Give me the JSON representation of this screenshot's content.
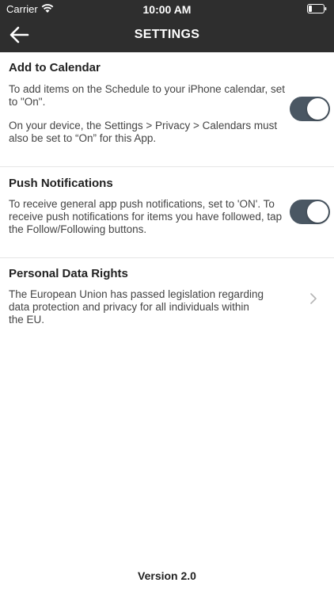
{
  "status_bar": {
    "carrier": "Carrier",
    "time": "10:00 AM"
  },
  "header": {
    "title": "SETTINGS",
    "back_icon": "arrow-left-icon"
  },
  "sections": [
    {
      "title": "Add to Calendar",
      "text_lines": [
        "To add items on the Schedule to your iPhone calendar, set",
        "to \"On\".",
        "On your device, the Settings > Privacy > Calendars must",
        "also be set to “On” for this App."
      ],
      "toggle_on": true
    },
    {
      "title": "Push Notifications",
      "text_lines": [
        "To receive general app push notifications, set to 'ON'. To",
        "receive push notifications for items you have followed, tap",
        "the Follow/Following buttons."
      ],
      "toggle_on": true
    },
    {
      "title": "Personal Data Rights",
      "text_lines": [
        "The European Union has passed legislation regarding",
        "data protection and privacy for all individuals within",
        "the EU."
      ],
      "chevron_icon": "chevron-right-icon"
    }
  ],
  "footer": {
    "version": "Version 2.0"
  },
  "colors": {
    "header_bg": "#2e2e2e",
    "toggle_on": "#4a5763",
    "divider": "#e6e6e6"
  }
}
